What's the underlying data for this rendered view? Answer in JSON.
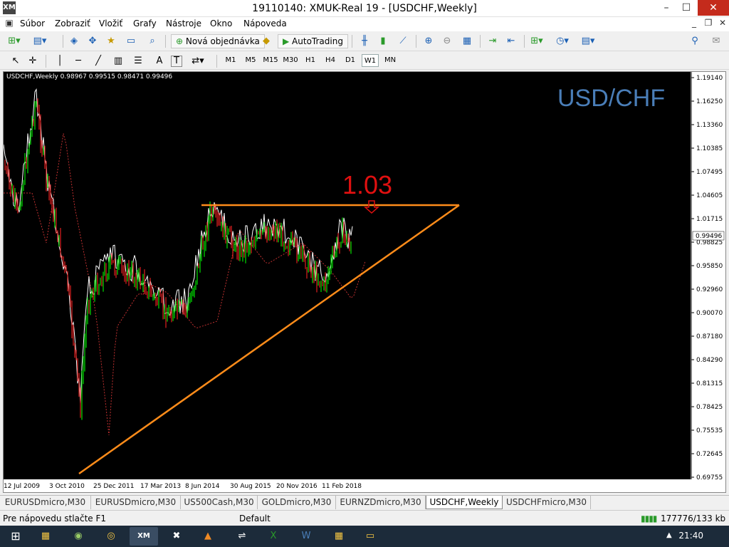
{
  "window": {
    "title": "19110140: XMUK-Real 19 - [USDCHF,Weekly]",
    "app_icon": "XM",
    "controls": {
      "minimize": "–",
      "maximize": "☐",
      "close": "✕"
    }
  },
  "menu": {
    "items": [
      "Súbor",
      "Zobraziť",
      "Vložiť",
      "Grafy",
      "Nástroje",
      "Okno",
      "Nápoveda"
    ],
    "mdi_controls": {
      "minimize": "_",
      "restore": "❐",
      "close": "✕"
    }
  },
  "toolbar1": {
    "new_order_label": "Nová objednávka",
    "autotrading_label": "AutoTrading"
  },
  "toolbar2": {
    "timeframes": [
      "M1",
      "M5",
      "M15",
      "M30",
      "H1",
      "H4",
      "D1",
      "W1",
      "MN"
    ],
    "active_timeframe": "W1",
    "text_tool": "A",
    "label_tool": "T"
  },
  "chart": {
    "header": "USDCHF,Weekly  0.98967 0.99515 0.98471 0.99496",
    "symbol_overlay": "USD/CHF",
    "annotation": "1.03",
    "price_labels": [
      "1.19140",
      "1.16250",
      "1.13360",
      "1.10385",
      "1.07495",
      "1.04605",
      "1.01715",
      "0.98825",
      "0.95850",
      "0.92960",
      "0.90070",
      "0.87180",
      "0.84290",
      "0.81315",
      "0.78425",
      "0.75535",
      "0.72645",
      "0.69755"
    ],
    "current_price": "0.99496",
    "date_labels": [
      "12 Jul 2009",
      "3 Oct 2010",
      "25 Dec 2011",
      "17 Mar 2013",
      "8 Jun 2014",
      "30 Aug 2015",
      "20 Nov 2016",
      "11 Feb 2018"
    ],
    "colors": {
      "background": "#000000",
      "overlay_text": "#4a7eb8",
      "annotation": "#e01010",
      "trendline": "#ff8c1a",
      "bull": "#00e000",
      "bear": "#e02020",
      "line": "#ffffff",
      "ma": "#c03030"
    }
  },
  "tabs": {
    "items": [
      "EURUSDmicro,M30",
      "EURUSDmicro,M30",
      "US500Cash,M30",
      "GOLDmicro,M30",
      "EURNZDmicro,M30",
      "USDCHF,Weekly",
      "USDCHFmicro,M30"
    ],
    "active": "USDCHF,Weekly"
  },
  "status": {
    "help": "Pre nápovedu stlačte F1",
    "profile": "Default",
    "connection": "177776/133 kb"
  },
  "taskbar": {
    "clock": "21:40"
  }
}
